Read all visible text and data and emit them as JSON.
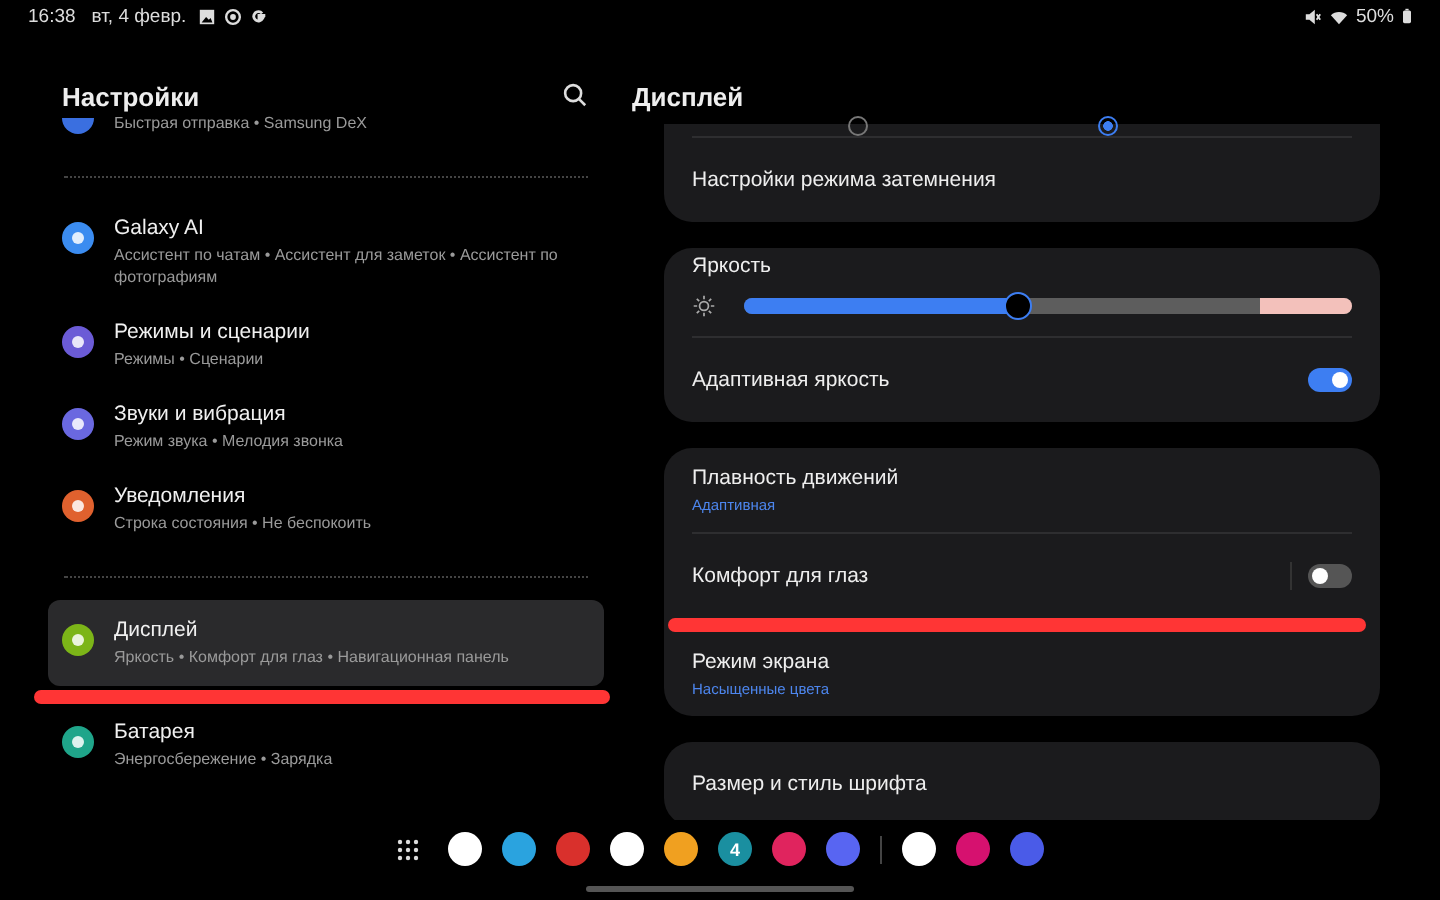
{
  "status_bar": {
    "time": "16:38",
    "date": "вт, 4 февр.",
    "battery": "50%"
  },
  "settings_pane": {
    "title": "Настройки",
    "groups": [
      [
        {
          "subtitle": "Быстрая отправка • Samsung DeX",
          "color": "#3a6fe0",
          "selected": false
        }
      ],
      [
        {
          "title": "Galaxy AI",
          "subtitle": "Ассистент по чатам • Ассистент для заметок • Ассистент по фотографиям",
          "color": "#3b8cf0",
          "selected": false
        },
        {
          "title": "Режимы и сценарии",
          "subtitle": "Режимы • Сценарии",
          "color": "#6b5bd6",
          "selected": false
        },
        {
          "title": "Звуки и вибрация",
          "subtitle": "Режим звука • Мелодия звонка",
          "color": "#6a68e0",
          "selected": false
        },
        {
          "title": "Уведомления",
          "subtitle": "Строка состояния • Не беспокоить",
          "color": "#e0612e",
          "selected": false
        }
      ],
      [
        {
          "title": "Дисплей",
          "subtitle": "Яркость • Комфорт для глаз • Навигационная панель",
          "color": "#7cb518",
          "selected": true,
          "underlined": true
        },
        {
          "title": "Батарея",
          "subtitle": "Энергосбережение • Зарядка",
          "color": "#1fa58a",
          "selected": false
        }
      ]
    ]
  },
  "display_pane": {
    "title": "Дисплей",
    "radios": [
      {
        "selected": false
      },
      {
        "selected": true
      }
    ],
    "cards": [
      [
        {
          "kind": "link",
          "label": "Настройки режима затемнения"
        }
      ],
      [
        {
          "kind": "slider",
          "label": "Яркость",
          "level": 0.45
        },
        {
          "kind": "toggle",
          "label": "Адаптивная яркость",
          "on": true
        }
      ],
      [
        {
          "kind": "link",
          "label": "Плавность движений",
          "value": "Адаптивная"
        },
        {
          "kind": "toggle",
          "label": "Комфорт для глаз",
          "on": false,
          "underlined": true
        },
        {
          "kind": "link",
          "label": "Режим экрана",
          "value": "Насыщенные цвета"
        }
      ],
      [
        {
          "kind": "link",
          "label": "Размер и стиль шрифта"
        }
      ]
    ]
  },
  "dock": {
    "apps": [
      {
        "color": "#ffffff"
      },
      {
        "color": "#2aa3df"
      },
      {
        "color": "#d9302c"
      },
      {
        "color": "#ffffff"
      },
      {
        "color": "#f0a020"
      },
      {
        "color": "#1a8fa0",
        "text": "4"
      },
      {
        "color": "#e0245e"
      },
      {
        "color": "#5865f2"
      },
      {
        "color": "#ffffff"
      },
      {
        "color": "#d6116f"
      },
      {
        "color": "#4a5be8"
      }
    ]
  }
}
